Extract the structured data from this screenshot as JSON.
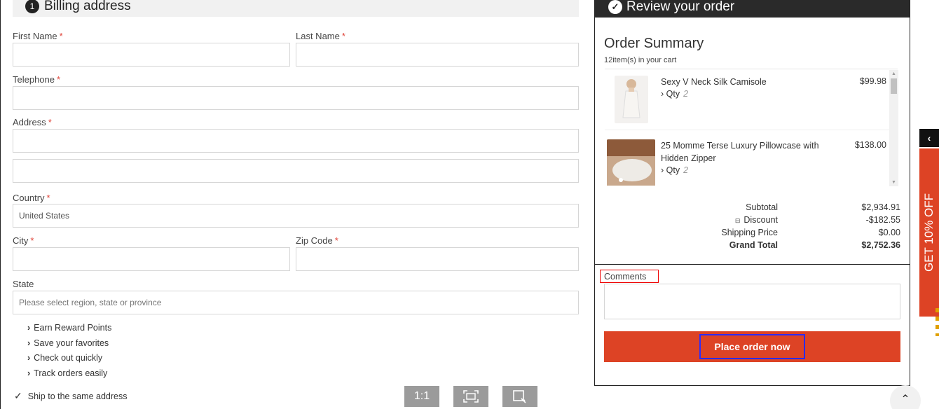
{
  "billing": {
    "step": "1",
    "title": "Billing address",
    "fields": {
      "first_name": {
        "label": "First Name",
        "required": "*",
        "value": ""
      },
      "last_name": {
        "label": "Last Name",
        "required": "*",
        "value": ""
      },
      "telephone": {
        "label": "Telephone",
        "required": "*",
        "value": ""
      },
      "address": {
        "label": "Address",
        "required": "*",
        "value": "",
        "value2": ""
      },
      "country": {
        "label": "Country",
        "required": "*",
        "value": "United States"
      },
      "city": {
        "label": "City",
        "required": "*",
        "value": ""
      },
      "zip": {
        "label": "Zip Code",
        "required": "*",
        "value": ""
      },
      "state": {
        "label": "State",
        "placeholder": "Please select region, state or province"
      }
    },
    "benefits": [
      "Earn Reward Points",
      "Save your favorites",
      "Check out quickly",
      "Track orders easily"
    ],
    "ship_same": {
      "label": "Ship to the same address",
      "checked": true,
      "check_glyph": "✓"
    }
  },
  "viewer": {
    "one_to_one": "1:1",
    "fit_icon": "fit-screen-icon",
    "crop_icon": "crop-icon"
  },
  "review": {
    "title": "Review your order",
    "check_glyph": "✓",
    "summary_title": "Order Summary",
    "cart_count": "12item(s) in your cart",
    "items": [
      {
        "name": "Sexy V Neck Silk Camisole",
        "qty_label": "Qty",
        "qty": "2",
        "price": "$99.98"
      },
      {
        "name": "25 Momme Terse Luxury Pillowcase with Hidden Zipper",
        "qty_label": "Qty",
        "qty": "2",
        "price": "$138.00"
      }
    ],
    "totals": {
      "subtotal": {
        "label": "Subtotal",
        "value": "$2,934.91"
      },
      "discount": {
        "label": "Discount",
        "value": "-$182.55",
        "toggle": "⊟"
      },
      "shipping": {
        "label": "Shipping Price",
        "value": "$0.00"
      },
      "grand": {
        "label": "Grand Total",
        "value": "$2,752.36"
      }
    },
    "comments_label": "Comments",
    "comments_value": "",
    "place_order": "Place order now"
  },
  "promo": {
    "text": "GET 10% OFF",
    "toggle": "‹"
  },
  "scroll_top": "⌃",
  "colors": {
    "accent": "#dd4325",
    "header_dark": "#2a2a2a",
    "required": "#e0453a"
  }
}
